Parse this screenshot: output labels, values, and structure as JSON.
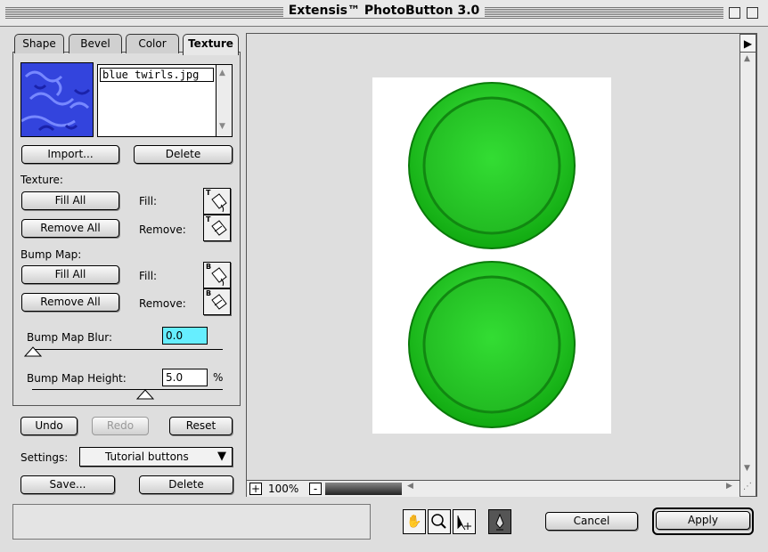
{
  "window": {
    "title": "Extensis™ PhotoButton 3.0"
  },
  "tabs": [
    {
      "label": "Shape",
      "active": false
    },
    {
      "label": "Bevel",
      "active": false
    },
    {
      "label": "Color",
      "active": false
    },
    {
      "label": "Texture",
      "active": true
    }
  ],
  "texture_list": {
    "selected_item": "blue twirls.jpg"
  },
  "texture_buttons": {
    "import": "Import...",
    "delete": "Delete"
  },
  "texture_section": {
    "heading": "Texture:",
    "fill_all": "Fill All",
    "fill_label": "Fill:",
    "remove_all": "Remove All",
    "remove_label": "Remove:",
    "fill_bucket_letter": "T",
    "remove_bucket_letter": "T"
  },
  "bump_section": {
    "heading": "Bump Map:",
    "fill_all": "Fill All",
    "fill_label": "Fill:",
    "remove_all": "Remove All",
    "remove_label": "Remove:",
    "fill_bucket_letter": "B",
    "remove_bucket_letter": "B"
  },
  "blur": {
    "label": "Bump Map Blur:",
    "value": "0.0",
    "slider_fraction": 0.0
  },
  "height": {
    "label": "Bump Map Height:",
    "value": "5.0",
    "unit": "%",
    "slider_fraction": 0.5
  },
  "history": {
    "undo": "Undo",
    "redo": "Redo",
    "reset": "Reset"
  },
  "settings": {
    "label": "Settings:",
    "selected": "Tutorial buttons",
    "save": "Save...",
    "delete": "Delete"
  },
  "preview": {
    "zoom": "100%",
    "zoom_in": "+",
    "zoom_out": "-"
  },
  "tools": [
    "hand-tool-icon",
    "zoom-tool-icon",
    "move-tool-icon",
    "pen-tool-icon"
  ],
  "actions": {
    "cancel": "Cancel",
    "apply": "Apply"
  },
  "colors": {
    "accent_field": "#66eeff",
    "button_green": "#22cc22",
    "texture_blue": "#3344dd"
  }
}
